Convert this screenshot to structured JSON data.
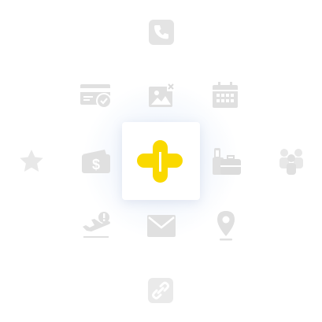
{
  "app": {
    "center_icon": "health-plus-logo-icon",
    "icons": [
      "phone-icon",
      "credit-card-check-icon",
      "image-remove-icon",
      "calendar-icon",
      "star-icon",
      "cash-wallet-icon",
      "luggage-icon",
      "people-group-icon",
      "flight-alert-icon",
      "email-icon",
      "location-pin-icon",
      "link-icon"
    ]
  },
  "colors": {
    "accent": "#FAD900",
    "icon_gray": "#DCDCDC",
    "background": "#FFFFFF"
  }
}
